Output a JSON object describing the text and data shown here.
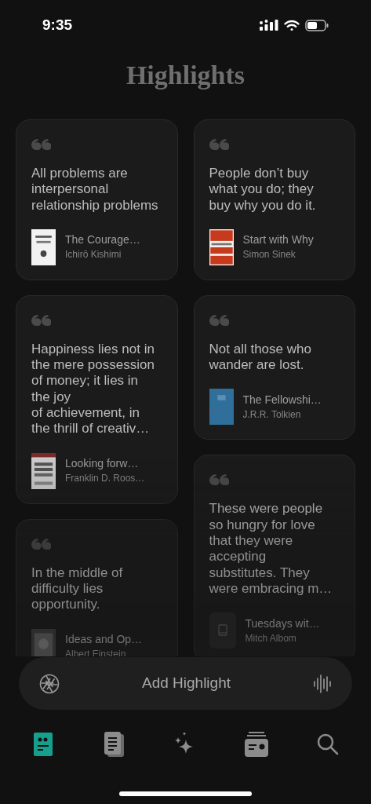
{
  "status_bar": {
    "time": "9:35"
  },
  "title": "Highlights",
  "columns": [
    [
      {
        "quote": "All problems are interpersonal relationship problems",
        "book": "The Courage…",
        "author": "Ichirō Kishimi"
      },
      {
        "quote": "Happiness lies not in the mere possession of money; it lies in the joy\nof achievement, in the thrill of creativ…",
        "book": "Looking forw…",
        "author": "Franklin D. Roos…"
      },
      {
        "quote": "In the middle of difficulty lies opportunity.",
        "book": "Ideas and Op…",
        "author": "Albert Einstein"
      }
    ],
    [
      {
        "quote": "People don’t buy what you do; they buy why you do it.",
        "book": "Start with Why",
        "author": "Simon Sinek"
      },
      {
        "quote": "Not all those who wander are lost.",
        "book": "The Fellowshi…",
        "author": "J.R.R. Tolkien"
      },
      {
        "quote": "These were people so hungry for love that they were accepting substitutes. They were embracing m…",
        "book": "Tuesdays wit…",
        "author": "Mitch Albom",
        "cover": {
          "kind": "placeholder"
        }
      }
    ]
  ],
  "add_bar": {
    "label": "Add Highlight"
  },
  "tabs": [
    {
      "kind": "quotes",
      "selected": true
    },
    {
      "kind": "pages",
      "selected": false
    },
    {
      "kind": "sparkles",
      "selected": false
    },
    {
      "kind": "inbox",
      "selected": false
    },
    {
      "kind": "search",
      "selected": false
    }
  ]
}
